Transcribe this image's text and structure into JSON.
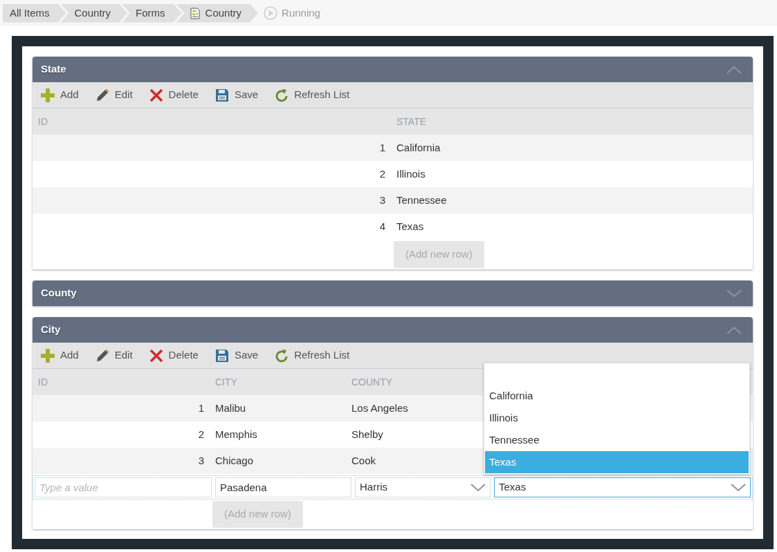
{
  "breadcrumbs": [
    {
      "label": "All Items",
      "kind": "plain"
    },
    {
      "label": "Country",
      "kind": "plain"
    },
    {
      "label": "Forms",
      "kind": "plain"
    },
    {
      "label": "Country",
      "kind": "form"
    },
    {
      "label": "Running",
      "kind": "running"
    }
  ],
  "panels": [
    {
      "title": "State",
      "expanded": true,
      "toolbar": [
        {
          "label": "Add",
          "kind": "add"
        },
        {
          "label": "Edit",
          "kind": "edit"
        },
        {
          "label": "Delete",
          "kind": "delete"
        },
        {
          "label": "Save",
          "kind": "save"
        },
        {
          "label": "Refresh List",
          "kind": "refresh"
        }
      ],
      "columns": [
        "ID",
        "STATE"
      ],
      "rows": [
        [
          "1",
          "California"
        ],
        [
          "2",
          "Illinois"
        ],
        [
          "3",
          "Tennessee"
        ],
        [
          "4",
          "Texas"
        ]
      ],
      "add_row": "(Add new row)"
    },
    {
      "title": "County",
      "expanded": false
    },
    {
      "title": "City",
      "expanded": true,
      "toolbar": [
        {
          "label": "Add",
          "kind": "add"
        },
        {
          "label": "Edit",
          "kind": "edit"
        },
        {
          "label": "Delete",
          "kind": "delete"
        },
        {
          "label": "Save",
          "kind": "save"
        },
        {
          "label": "Refresh List",
          "kind": "refresh"
        }
      ],
      "columns": [
        "ID",
        "CITY",
        "COUNTY"
      ],
      "rows": [
        [
          "1",
          "Malibu",
          "Los Angeles"
        ],
        [
          "2",
          "Memphis",
          "Shelby"
        ],
        [
          "3",
          "Chicago",
          "Cook"
        ]
      ],
      "edit_row": [
        {
          "kind": "text",
          "placeholder": "Type a value",
          "focused": false
        },
        {
          "kind": "text",
          "value": "Pasadena",
          "focused": false
        },
        {
          "kind": "select",
          "value": "Harris",
          "focused": false
        },
        {
          "kind": "select",
          "value": "Texas",
          "focused": true
        }
      ],
      "dropdown": [
        {
          "label": "California",
          "selected": false
        },
        {
          "label": "Illinois",
          "selected": false
        },
        {
          "label": "Tennessee",
          "selected": false
        },
        {
          "label": "Texas",
          "selected": true
        }
      ],
      "add_row": "(Add new row)"
    }
  ]
}
